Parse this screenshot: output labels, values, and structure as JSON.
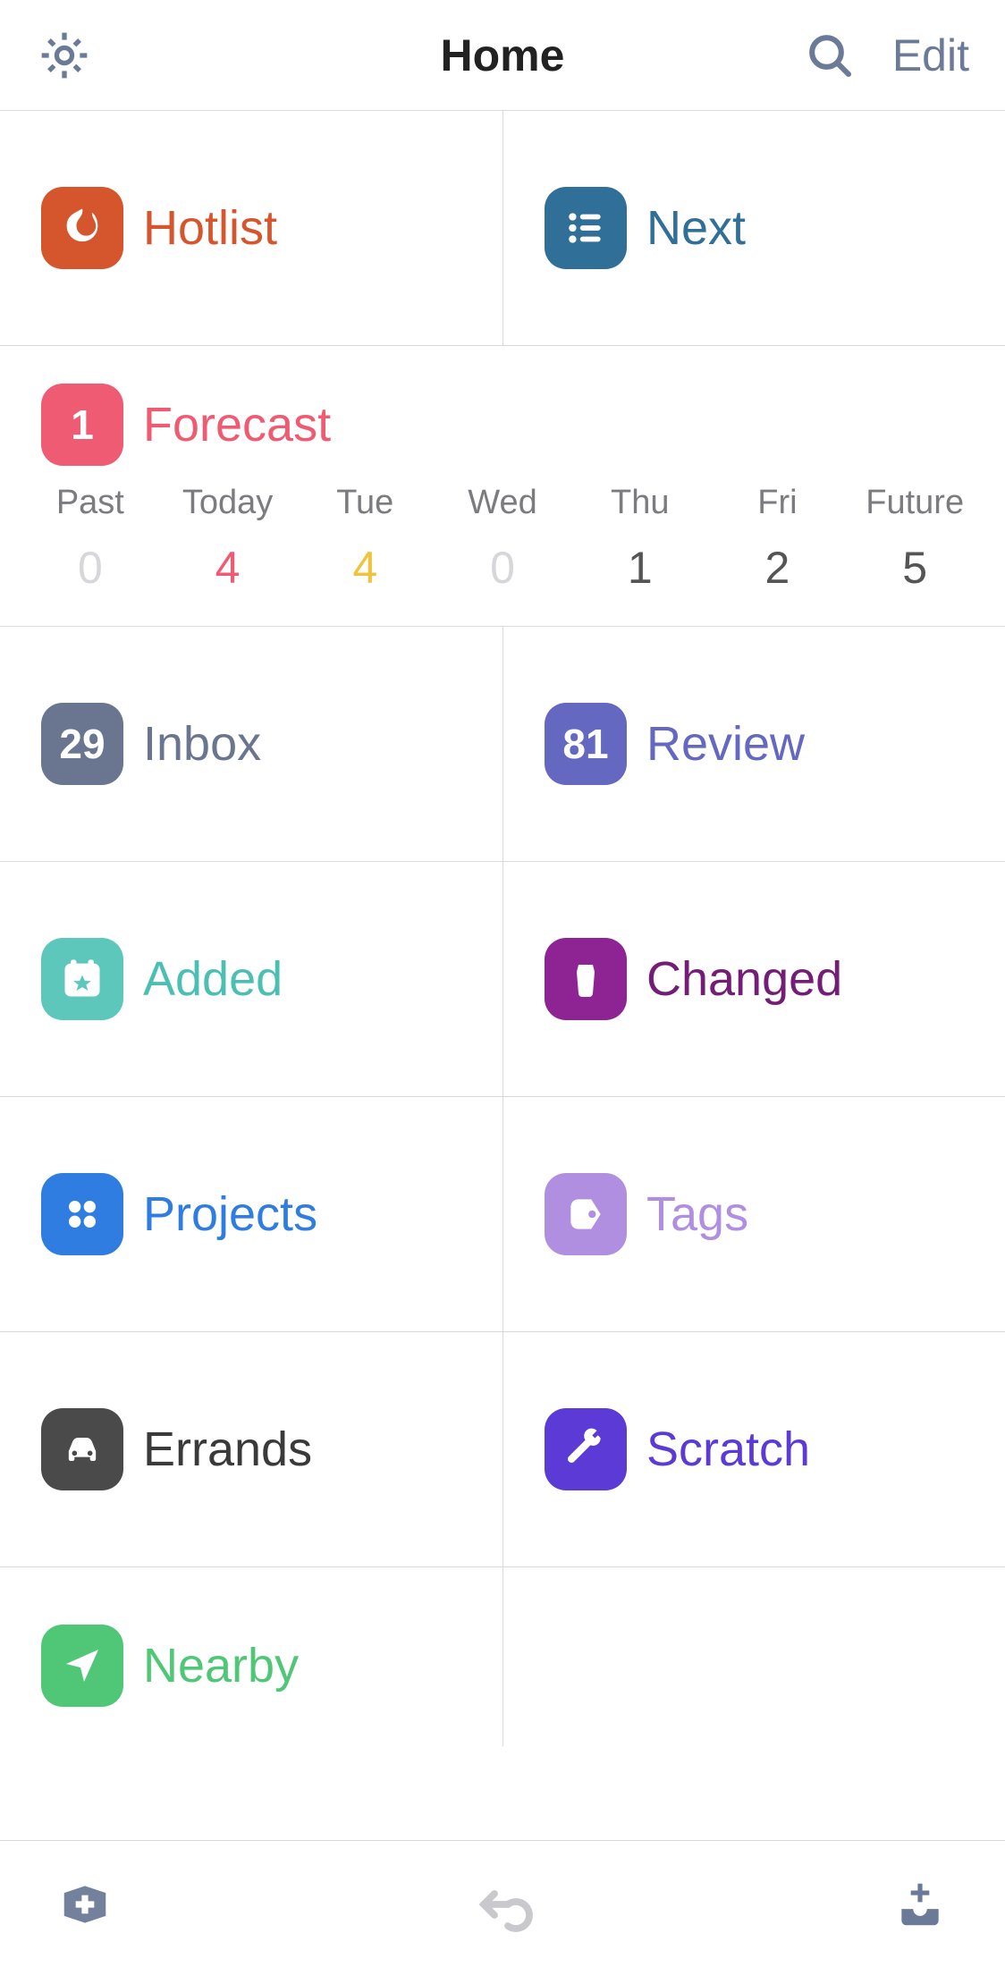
{
  "header": {
    "title": "Home",
    "edit_label": "Edit"
  },
  "tiles": {
    "hotlist": {
      "label": "Hotlist",
      "color": "#d5552d",
      "text_color": "#d5552d",
      "icon": "flame"
    },
    "next": {
      "label": "Next",
      "color": "#2f6f98",
      "text_color": "#2f6f98",
      "icon": "list"
    },
    "forecast": {
      "label": "Forecast",
      "color": "#ef5b72",
      "text_color": "#ef5b72",
      "badge_text": "1"
    },
    "inbox": {
      "label": "Inbox",
      "color": "#6a7690",
      "text_color": "#6a7690",
      "badge_text": "29"
    },
    "review": {
      "label": "Review",
      "color": "#6568c1",
      "text_color": "#6568c1",
      "badge_text": "81"
    },
    "added": {
      "label": "Added",
      "color": "#5dc7bc",
      "text_color": "#4cbfb3",
      "icon": "calendar-star"
    },
    "changed": {
      "label": "Changed",
      "color": "#8e2394",
      "text_color": "#741d77",
      "icon": "cup"
    },
    "projects": {
      "label": "Projects",
      "color": "#2f7de0",
      "text_color": "#2f7de0",
      "icon": "dots4"
    },
    "tags": {
      "label": "Tags",
      "color": "#b08fe0",
      "text_color": "#b08fe0",
      "icon": "tag"
    },
    "errands": {
      "label": "Errands",
      "color": "#4a4a4a",
      "text_color": "#3a3a3a",
      "icon": "car"
    },
    "scratch": {
      "label": "Scratch",
      "color": "#5b3ad6",
      "text_color": "#5b3ad6",
      "icon": "wrench"
    },
    "nearby": {
      "label": "Nearby",
      "color": "#4fc776",
      "text_color": "#4fc776",
      "icon": "location"
    }
  },
  "forecast_days": [
    {
      "label": "Past",
      "count": "0",
      "style": "dim"
    },
    {
      "label": "Today",
      "count": "4",
      "style": "#ef5b72"
    },
    {
      "label": "Tue",
      "count": "4",
      "style": "#f0c33c"
    },
    {
      "label": "Wed",
      "count": "0",
      "style": "dim"
    },
    {
      "label": "Thu",
      "count": "1",
      "style": "normal"
    },
    {
      "label": "Fri",
      "count": "2",
      "style": "normal"
    },
    {
      "label": "Future",
      "count": "5",
      "style": "normal"
    }
  ]
}
